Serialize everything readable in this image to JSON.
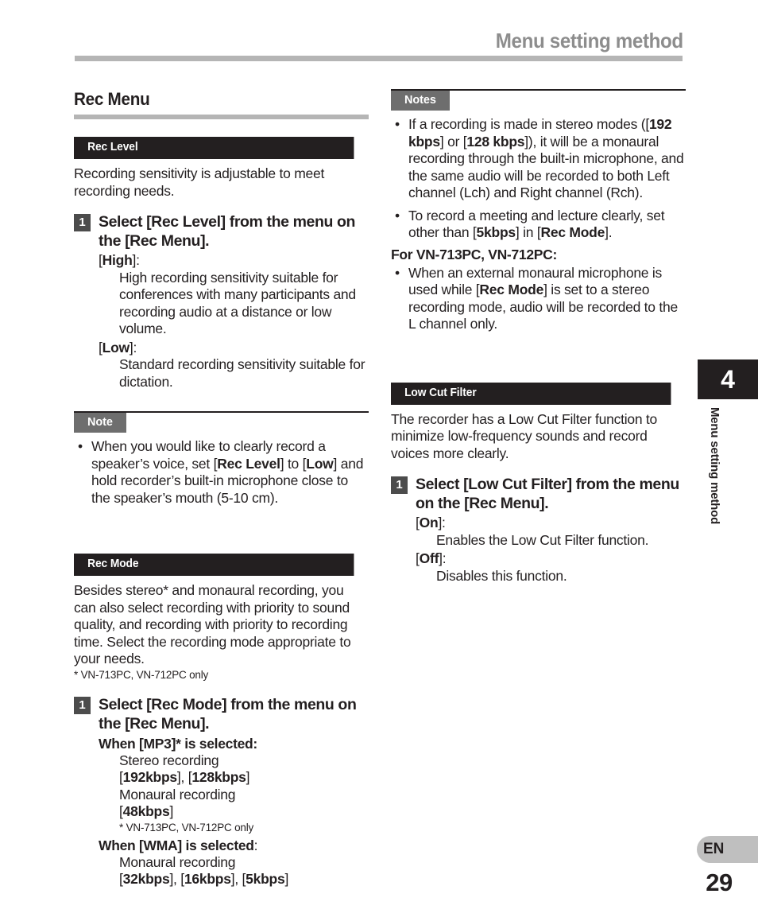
{
  "header": {
    "title": "Menu setting method"
  },
  "left_column": {
    "section_title": "Rec Menu",
    "rec_level": {
      "bar_label": "Rec Level",
      "intro": "Recording sensitivity is adjustable to meet recording needs.",
      "step_number": "1",
      "step_prefix": "Select [",
      "step_bold1": "Rec Level",
      "step_mid": "] from the menu on the [",
      "step_bold2": "Rec Menu",
      "step_suffix": "].",
      "opt_high_open": "[",
      "opt_high_label": "High",
      "opt_high_close": "]:",
      "opt_high_desc": "High recording sensitivity suitable for conferences with many participants and recording audio at a distance or low volume.",
      "opt_low_open": "[",
      "opt_low_label": "Low",
      "opt_low_close": "]:",
      "opt_low_desc": "Standard recording sensitivity suitable for dictation."
    },
    "note": {
      "bar_label": "Note",
      "bullet": "•",
      "text_1": "When you would like to clearly record a speaker’s voice, set [",
      "bold_1": "Rec Level",
      "text_2": "] to [",
      "bold_2": "Low",
      "text_3": "] and hold recorder’s built-in microphone close to the speaker’s mouth (5-10 cm)."
    },
    "rec_mode": {
      "bar_label": "Rec Mode",
      "intro": "Besides stereo* and monaural recording, you can also select recording with priority to sound quality, and recording with priority to recording time. Select the recording mode appropriate to your needs.",
      "footnote": "* VN-713PC, VN-712PC only",
      "step_number": "1",
      "step_prefix": "Select [",
      "step_bold1": "Rec Mode",
      "step_mid": "] from the menu on the [",
      "step_bold2": "Rec Menu",
      "step_suffix": "].",
      "mp3_head_a": "When [",
      "mp3_head_b": "MP3",
      "mp3_head_c": "]* is selected:",
      "mp3_stereo_label": "Stereo recording",
      "mp3_stereo_rates": "[192kbps], [128kbps]",
      "mp3_mono_label": "Monaural recording",
      "mp3_mono_rates": "[48kbps]",
      "mp3_footnote": "* VN-713PC, VN-712PC only",
      "wma_head_a": "When [",
      "wma_head_b": "WMA",
      "wma_head_c": "] is selected",
      "wma_head_d": ":",
      "wma_mono_label": "Monaural recording",
      "wma_mono_rates": "[32kbps], [16kbps], [5kbps]"
    }
  },
  "right_column": {
    "notes": {
      "bar_label": "Notes",
      "bullet": "•",
      "note1_t1": "If a recording is made in stereo modes ([",
      "note1_b1": "192 kbps",
      "note1_t2": "] or [",
      "note1_b2": "128 kbps",
      "note1_t3": "]), it will be a monaural recording through the built-in microphone, and the same audio will be recorded to both Left channel (Lch) and Right channel (Rch).",
      "note2_t1": "To record a meeting and lecture clearly, set other than [",
      "note2_b1": "5kbps",
      "note2_t2": "] in [",
      "note2_b2": "Rec Mode",
      "note2_t3": "].",
      "device_head": "For VN-713PC, VN-712PC:",
      "note3_t1": "When an external monaural microphone is used while [",
      "note3_b1": "Rec Mode",
      "note3_t2": "] is set to a stereo recording mode, audio will be recorded to the L channel only."
    },
    "low_cut_filter": {
      "bar_label": "Low Cut Filter",
      "intro": "The recorder has a Low Cut Filter function to minimize low-frequency sounds and record voices more clearly.",
      "step_number": "1",
      "step_prefix": "Select [",
      "step_bold1": "Low Cut Filter",
      "step_mid": "] from the menu on the [",
      "step_bold2": "Rec Menu",
      "step_suffix": "].",
      "opt_on_open": "[",
      "opt_on_label": "On",
      "opt_on_close": "]:",
      "opt_on_desc": "Enables the Low Cut Filter function.",
      "opt_off_open": "[",
      "opt_off_label": "Off",
      "opt_off_close": "]:",
      "opt_off_desc": "Disables this function."
    }
  },
  "chapter_tab": {
    "number": "4",
    "label": "Menu setting method"
  },
  "footer": {
    "language": "EN",
    "page_number": "29"
  },
  "colors": {
    "bar_black": "#231f20",
    "bar_gray": "#6e6e6e",
    "rule_gray": "#b5b5b5",
    "step_badge": "#4c4c4c",
    "badge_gray": "#bfbfbf",
    "header_gray": "#8d8d8d"
  }
}
